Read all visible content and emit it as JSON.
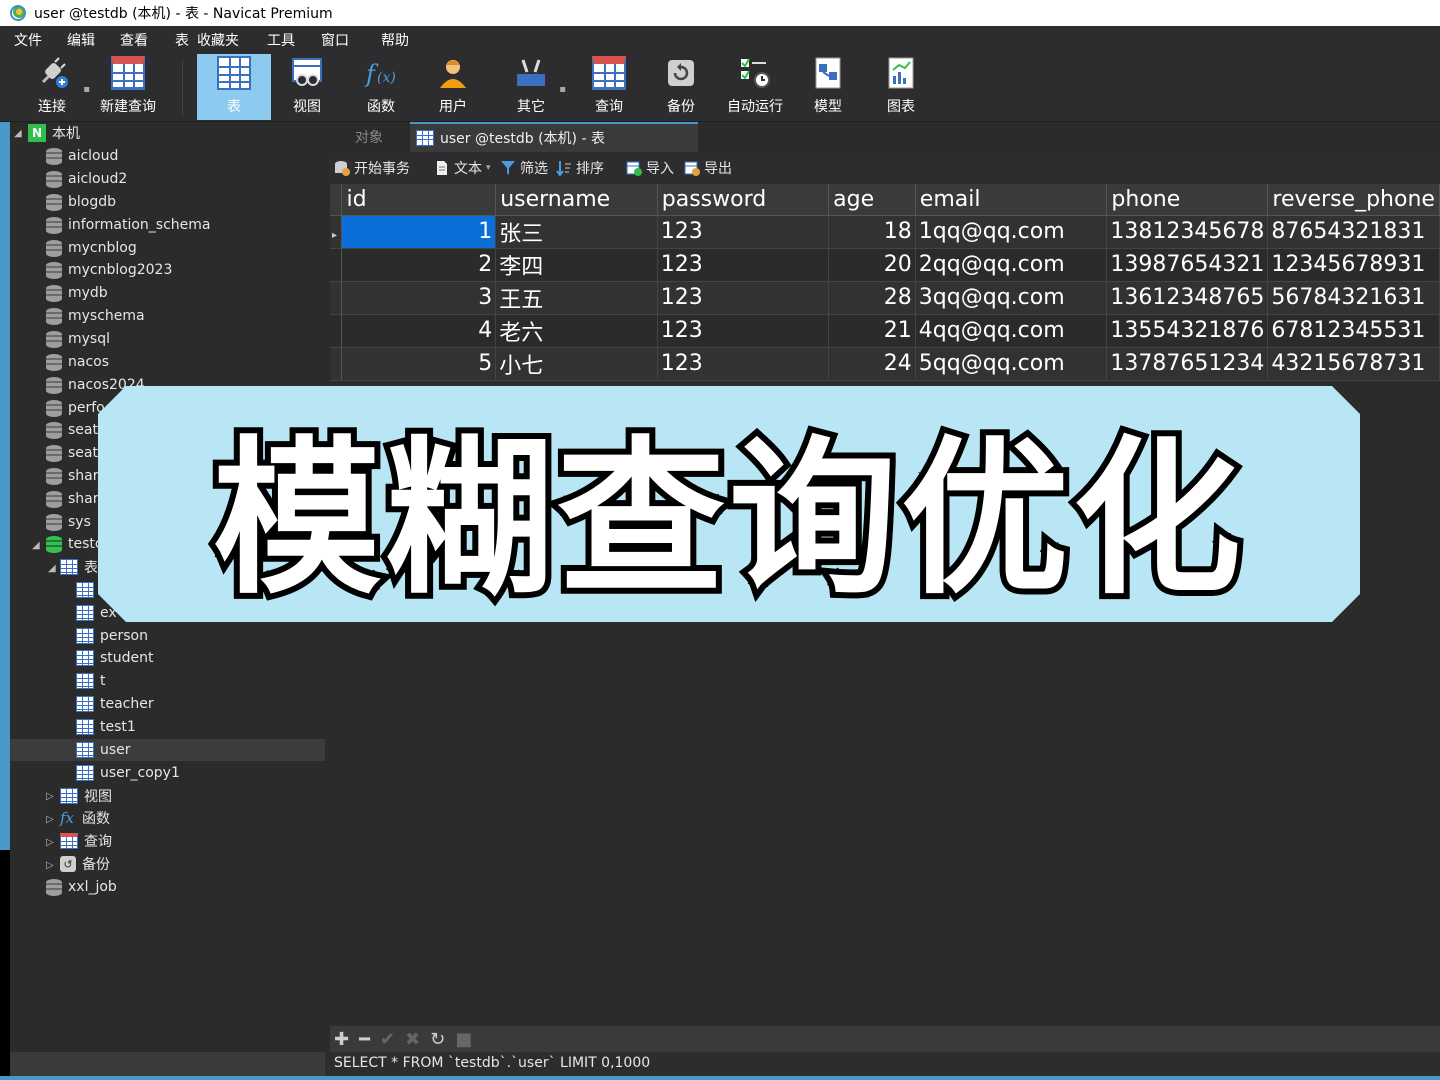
{
  "window": {
    "title": "user @testdb (本机) - 表 - Navicat Premium"
  },
  "menu": [
    "文件",
    "编辑",
    "查看",
    "表",
    "收藏夹",
    "工具",
    "窗口",
    "帮助"
  ],
  "toolbar": [
    {
      "label": "连接",
      "icon": "plug-icon"
    },
    {
      "label": "新建查询",
      "icon": "new-query-icon"
    },
    {
      "label": "表",
      "icon": "table-icon",
      "active": true
    },
    {
      "label": "视图",
      "icon": "view-icon"
    },
    {
      "label": "函数",
      "icon": "function-icon"
    },
    {
      "label": "用户",
      "icon": "user-icon"
    },
    {
      "label": "其它",
      "icon": "tools-icon"
    },
    {
      "label": "查询",
      "icon": "query-icon"
    },
    {
      "label": "备份",
      "icon": "backup-icon"
    },
    {
      "label": "自动运行",
      "icon": "schedule-icon"
    },
    {
      "label": "模型",
      "icon": "model-icon"
    },
    {
      "label": "图表",
      "icon": "chart-icon"
    }
  ],
  "tree": {
    "root": "本机",
    "databases": [
      "aicloud",
      "aicloud2",
      "blogdb",
      "information_schema",
      "mycnblog",
      "mycnblog2023",
      "mydb",
      "myschema",
      "mysql",
      "nacos",
      "nacos2024",
      "perfo",
      "seata",
      "seata",
      "shar",
      "shar",
      "sys"
    ],
    "testdb": "testc",
    "tables_folder": "表",
    "tables": [
      "",
      "ex",
      "person",
      "student",
      "t",
      "teacher",
      "test1",
      "user",
      "user_copy1"
    ],
    "folders": [
      "视图",
      "函数",
      "查询",
      "备份"
    ],
    "after": "xxl_job"
  },
  "tabs": {
    "objects": "对象",
    "current": "user @testdb (本机) - 表"
  },
  "subtoolbar": {
    "begin_tx": "开始事务",
    "text": "文本",
    "filter": "筛选",
    "sort": "排序",
    "import": "导入",
    "export": "导出"
  },
  "grid": {
    "columns": [
      "id",
      "username",
      "password",
      "age",
      "email",
      "phone",
      "reverse_phone"
    ],
    "rows": [
      [
        "1",
        "张三",
        "123",
        "18",
        "1qq@qq.com",
        "13812345678",
        "87654321831"
      ],
      [
        "2",
        "李四",
        "123",
        "20",
        "2qq@qq.com",
        "13987654321",
        "12345678931"
      ],
      [
        "3",
        "王五",
        "123",
        "28",
        "3qq@qq.com",
        "13612348765",
        "56784321631"
      ],
      [
        "4",
        "老六",
        "123",
        "21",
        "4qq@qq.com",
        "13554321876",
        "67812345531"
      ],
      [
        "5",
        "小七",
        "123",
        "24",
        "5qq@qq.com",
        "13787651234",
        "43215678731"
      ]
    ]
  },
  "status": {
    "sql": "SELECT * FROM `testdb`.`user` LIMIT 0,1000"
  },
  "banner": {
    "text": "模糊查询优化"
  },
  "colors": {
    "accent": "#8ccbef",
    "selection": "#0a6fd8",
    "banner_bg": "#b9e6f5"
  }
}
